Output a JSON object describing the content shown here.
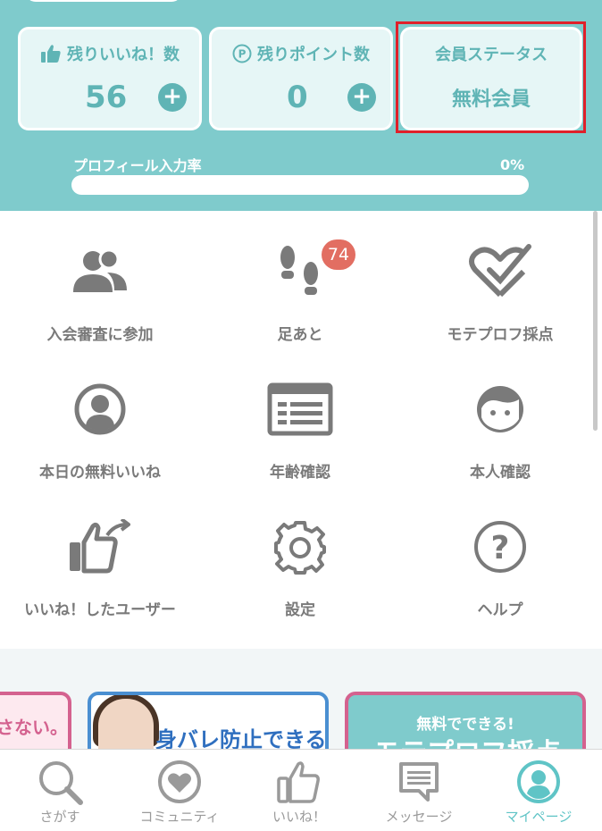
{
  "stats": {
    "likes": {
      "title": "残りいいね！数",
      "value": "56",
      "plus": "+",
      "icon": "thumbs-up-icon"
    },
    "points": {
      "title": "残りポイント数",
      "value": "0",
      "plus": "+",
      "icon": "point-coin-icon",
      "icon_glyph": "P"
    },
    "status": {
      "title": "会員ステータス",
      "value": "無料会員"
    }
  },
  "profile": {
    "label": "プロフィール入力率",
    "percent_text": "0%",
    "completion": 0
  },
  "menu": [
    {
      "label": "入会審査に参加",
      "icon": "users-icon"
    },
    {
      "label": "足あと",
      "icon": "footprints-icon",
      "badge": "74"
    },
    {
      "label": "モテプロフ採点",
      "icon": "heart-check-icon"
    },
    {
      "label": "本日の無料いいね",
      "icon": "user-circle-icon"
    },
    {
      "label": "年齢確認",
      "icon": "id-card-icon"
    },
    {
      "label": "本人確認",
      "icon": "face-icon"
    },
    {
      "label": "いいね！したユーザー",
      "icon": "like-share-icon"
    },
    {
      "label": "設定",
      "icon": "gear-icon"
    },
    {
      "label": "ヘルプ",
      "icon": "help-circle-icon",
      "icon_glyph": "?"
    }
  ],
  "banners": [
    {
      "text": "さない。"
    },
    {
      "text": "身バレ防止できる!"
    },
    {
      "subtitle": "無料でできる!",
      "text": "モテプロフ採点"
    }
  ],
  "nav": [
    {
      "label": "さがす",
      "icon": "search-icon"
    },
    {
      "label": "コミュニティ",
      "icon": "heart-circle-icon"
    },
    {
      "label": "いいね！",
      "icon": "thumbs-up-icon"
    },
    {
      "label": "メッセージ",
      "icon": "message-icon"
    },
    {
      "label": "マイページ",
      "icon": "mypage-icon",
      "active": true
    }
  ],
  "colors": {
    "teal": "#7fcbcc",
    "teal_dark": "#5fb4b5",
    "badge": "#e26e62",
    "highlight": "#e0202a",
    "active_nav": "#5fc4c6"
  }
}
